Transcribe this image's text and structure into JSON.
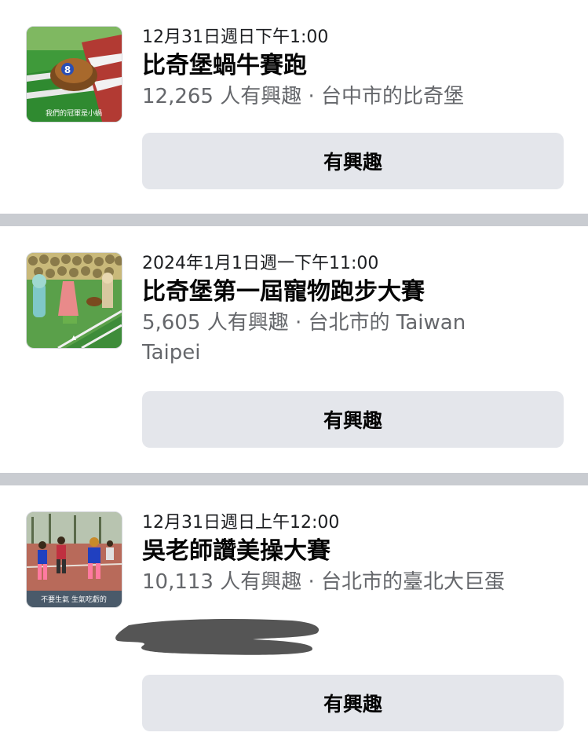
{
  "events": [
    {
      "date": "12月31日週日下午1:00",
      "title": "比奇堡蝸牛賽跑",
      "interest_count": "12,265 人有興趣",
      "separator": "·",
      "location": "台中市的比奇堡",
      "thumb_caption": "我們的冠軍是小蝸",
      "button_label": "有興趣"
    },
    {
      "date": "2024年1月1日週一下午11:00",
      "title": "比奇堡第一屆寵物跑步大賽",
      "interest_count": "5,605 人有興趣",
      "separator": "·",
      "location": "台北市的 Taiwan Taipei",
      "button_label": "有興趣"
    },
    {
      "date": "12月31日週日上午12:00",
      "title": "吳老師讚美操大賽",
      "interest_count": "10,113 人有興趣",
      "separator": "·",
      "location": "台北市的臺北大巨蛋",
      "thumb_caption": "不要生氣 生氣吃虧的",
      "button_label": "有興趣"
    }
  ],
  "colors": {
    "button_bg": "#e4e6eb",
    "separator": "#c9ccd1",
    "meta_text": "#65676b",
    "redaction": "#555555"
  }
}
